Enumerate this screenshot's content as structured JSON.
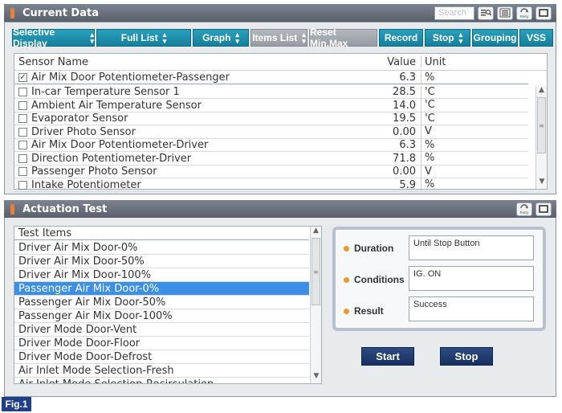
{
  "current_data": {
    "title": "Current Data",
    "search_placeholder": "Search",
    "toolbar": [
      {
        "label": "Selective Display",
        "dropdown": true,
        "disabled": false
      },
      {
        "label": "Full List",
        "dropdown": true,
        "disabled": false
      },
      {
        "label": "Graph",
        "dropdown": true,
        "disabled": false
      },
      {
        "label": "Items List",
        "dropdown": true,
        "disabled": true
      },
      {
        "label": "Reset Min.Max",
        "dropdown": false,
        "disabled": true
      },
      {
        "label": "Record",
        "dropdown": false,
        "disabled": false
      },
      {
        "label": "Stop",
        "dropdown": true,
        "disabled": false
      },
      {
        "label": "Grouping",
        "dropdown": false,
        "disabled": false
      },
      {
        "label": "VSS",
        "dropdown": false,
        "disabled": false
      }
    ],
    "columns": {
      "name": "Sensor Name",
      "value": "Value",
      "unit": "Unit"
    },
    "pinned_row": {
      "name": "Air Mix Door Potentiometer-Passenger",
      "value": "6.3",
      "unit": "%",
      "checked": true
    },
    "rows": [
      {
        "name": "In-car Temperature Sensor 1",
        "value": "28.5",
        "unit": "'C"
      },
      {
        "name": "Ambient Air Temperature Sensor",
        "value": "14.0",
        "unit": "'C"
      },
      {
        "name": "Evaporator Sensor",
        "value": "19.5",
        "unit": "'C"
      },
      {
        "name": "Driver Photo Sensor",
        "value": "0.00",
        "unit": "V"
      },
      {
        "name": "Air Mix Door Potentiometer-Driver",
        "value": "6.3",
        "unit": "%"
      },
      {
        "name": "Direction Potentiometer-Driver",
        "value": "71.8",
        "unit": "%"
      },
      {
        "name": "Passenger Photo Sensor",
        "value": "0.00",
        "unit": "V"
      },
      {
        "name": "Intake Potentiometer",
        "value": "5.9",
        "unit": "%"
      }
    ]
  },
  "actuation_test": {
    "title": "Actuation Test",
    "list_header": "Test Items",
    "items": [
      "Driver Air Mix Door-0%",
      "Driver Air Mix Door-50%",
      "Driver Air Mix Door-100%",
      "Passenger Air Mix Door-0%",
      "Passenger Air Mix Door-50%",
      "Passenger Air Mix Door-100%",
      "Driver Mode Door-Vent",
      "Driver Mode Door-Floor",
      "Driver Mode Door-Defrost",
      "Air Inlet Mode Selection-Fresh",
      "Air Inlet Mode Selection-Recirculation"
    ],
    "selected_index": 3,
    "duration_label": "Duration",
    "duration_value": "Until Stop Button",
    "conditions_label": "Conditions",
    "conditions_value": "IG. ON",
    "result_label": "Result",
    "result_value": "Success",
    "start_label": "Start",
    "stop_label": "Stop"
  },
  "figure_label": "Fig.1",
  "icons": {
    "retry_text": "Retry"
  },
  "colors": {
    "toolbar": "#1b8eab",
    "selected": "#3b8fe6",
    "action": "#1f3a6e"
  }
}
